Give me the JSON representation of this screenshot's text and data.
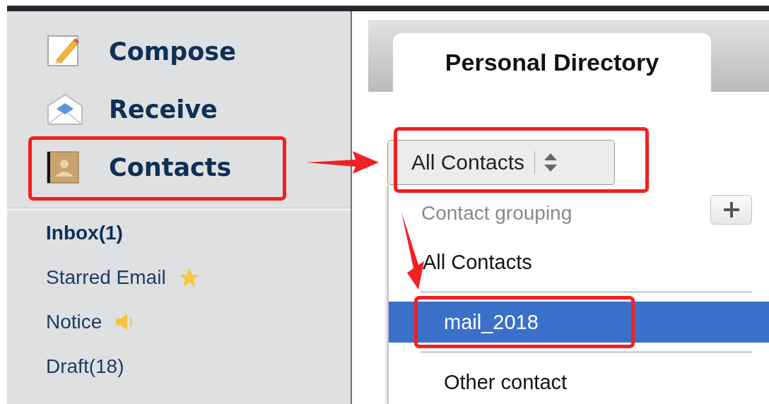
{
  "sidebar": {
    "actions": [
      {
        "label": "Compose",
        "kind": "compose"
      },
      {
        "label": "Receive",
        "kind": "receive"
      },
      {
        "label": "Contacts",
        "kind": "contacts"
      }
    ],
    "folders": [
      {
        "label": "Inbox(1)",
        "kind": "plain",
        "unread": true
      },
      {
        "label": "Starred Email",
        "kind": "starred",
        "unread": false
      },
      {
        "label": "Notice",
        "kind": "notice",
        "unread": false
      },
      {
        "label": "Draft(18)",
        "kind": "plain",
        "unread": false
      }
    ]
  },
  "tabs": [
    {
      "label": "Personal Directory",
      "selected": true
    }
  ],
  "group_select": {
    "value": "All Contacts"
  },
  "dropdown": {
    "header": "Contact grouping",
    "options": [
      {
        "label": "All Contacts",
        "selected": false
      },
      {
        "label": "mail_2018",
        "selected": true
      },
      {
        "label": "Other contact",
        "selected": false
      }
    ]
  }
}
